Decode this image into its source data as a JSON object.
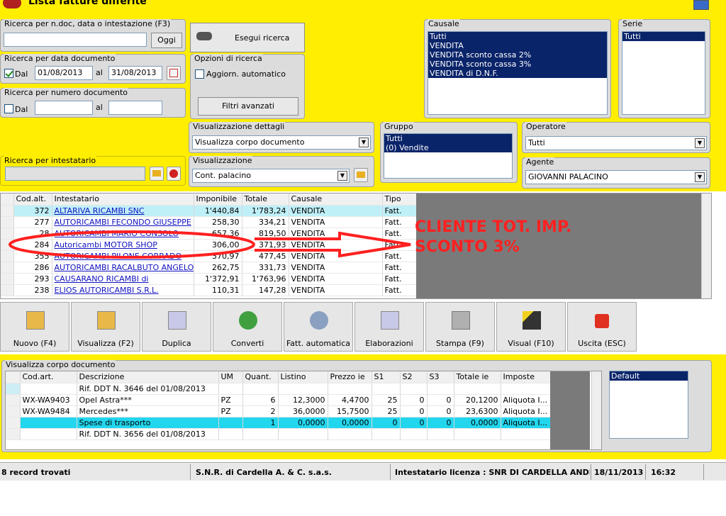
{
  "window": {
    "title": "Lista fatture differite"
  },
  "search": {
    "ndoc_label": "Ricerca per n.doc, data o intestazione (F3)",
    "ndoc_value": "",
    "oggi_label": "Oggi",
    "date_label": "Ricerca per data documento",
    "date_chk_label": "Dal",
    "date_from": "01/08/2013",
    "date_al": "al",
    "date_to": "31/08/2013",
    "num_label": "Ricerca per numero documento",
    "num_chk_label": "Dal",
    "num_al": "al",
    "intest_label": "Ricerca per intestatario"
  },
  "actions": {
    "search_button": "Esegui ricerca",
    "filters_button": "Filtri avanzati"
  },
  "options": {
    "label": "Opzioni di ricerca",
    "auto_update": "Aggiorn. automatico"
  },
  "causale": {
    "label": "Causale",
    "items": [
      "Tutti",
      "VENDITA",
      "VENDITA sconto cassa 2%",
      "VENDITA sconto cassa 3%",
      "VENDITA di D.N.F."
    ]
  },
  "serie": {
    "label": "Serie",
    "items": [
      "Tutti"
    ]
  },
  "details_view": {
    "label": "Visualizzazione dettagli",
    "value": "Visualizza corpo documento"
  },
  "view": {
    "label": "Visualizzazione",
    "value": "Cont. palacino"
  },
  "gruppo": {
    "label": "Gruppo",
    "items": [
      "Tutti",
      "(0) Vendite"
    ]
  },
  "operatore": {
    "label": "Operatore",
    "value": "Tutti"
  },
  "agente": {
    "label": "Agente",
    "value": "GIOVANNI PALACINO"
  },
  "grid": {
    "headers": [
      "Cod.alt.",
      "Intestatario",
      "Imponibile",
      "Totale",
      "Causale",
      "Tipo"
    ],
    "rows": [
      [
        "372",
        "ALTARIVA RICAMBI SNC",
        "1'440,84",
        "1'783,24",
        "VENDITA",
        "Fatt."
      ],
      [
        "277",
        "AUTORICAMBI FECONDO GIUSEPPE",
        "258,30",
        "334,21",
        "VENDITA",
        "Fatt."
      ],
      [
        "28",
        "AUTORICAMBI MARIO CONSOLO",
        "657,36",
        "819,50",
        "VENDITA",
        "Fatt."
      ],
      [
        "284",
        "Autoricambi MOTOR SHOP",
        "306,00",
        "371,93",
        "VENDITA",
        "Fatt."
      ],
      [
        "355",
        "AUTORICAMBI PILONE CORRADO",
        "370,97",
        "477,45",
        "VENDITA",
        "Fatt."
      ],
      [
        "286",
        "AUTORICAMBI RACALBUTO ANGELO",
        "262,75",
        "331,73",
        "VENDITA",
        "Fatt."
      ],
      [
        "293",
        "CAUSARANO RICAMBI di",
        "1'372,91",
        "1'763,96",
        "VENDITA",
        "Fatt."
      ],
      [
        "238",
        "ELIOS AUTORICAMBI S.R.L.",
        "110,31",
        "147,28",
        "VENDITA",
        "Fatt."
      ]
    ]
  },
  "annotation": {
    "line1": "CLIENTE TOT. IMP.",
    "line2": "SCONTO 3%",
    "color": "#ff2020"
  },
  "toolbar": {
    "buttons": [
      "Nuovo (F4)",
      "Visualizza (F2)",
      "Duplica",
      "Converti",
      "Fatt. automatica",
      "Elaborazioni",
      "Stampa (F9)",
      "Visual (F10)",
      "Uscita (ESC)"
    ]
  },
  "detail": {
    "label": "Visualizza corpo documento",
    "headers": [
      "Cod.art.",
      "Descrizione",
      "UM",
      "Quant.",
      "Listino",
      "Prezzo ie",
      "S1",
      "S2",
      "S3",
      "Totale ie",
      "Imposte"
    ],
    "rows": [
      [
        "",
        "Rif. DDT N. 3646 del 01/08/2013",
        "",
        "",
        "",
        "",
        "",
        "",
        "",
        "",
        ""
      ],
      [
        "WX-WA9403",
        "Opel Astra***",
        "PZ",
        "6",
        "12,3000",
        "4,4700",
        "25",
        "0",
        "0",
        "20,1200",
        "Aliquota I..."
      ],
      [
        "WX-WA9484",
        "Mercedes***",
        "PZ",
        "2",
        "36,0000",
        "15,7500",
        "25",
        "0",
        "0",
        "23,6300",
        "Aliquota I..."
      ],
      [
        "",
        "Spese di trasporto",
        "",
        "1",
        "0,0000",
        "0,0000",
        "0",
        "0",
        "0",
        "0,0000",
        "Aliquota I..."
      ],
      [
        "",
        "Rif. DDT N. 3656 del 01/08/2013",
        "",
        "",
        "",
        "",
        "",
        "",
        "",
        "",
        ""
      ]
    ],
    "side_list": [
      "Default"
    ]
  },
  "status": {
    "records": "8 record trovati",
    "company": "S.N.R. di Cardella A. & C. s.a.s.",
    "license": "Intestatario licenza : SNR DI CARDELLA ANDREA &",
    "date": "18/11/2013",
    "time": "16:32"
  }
}
